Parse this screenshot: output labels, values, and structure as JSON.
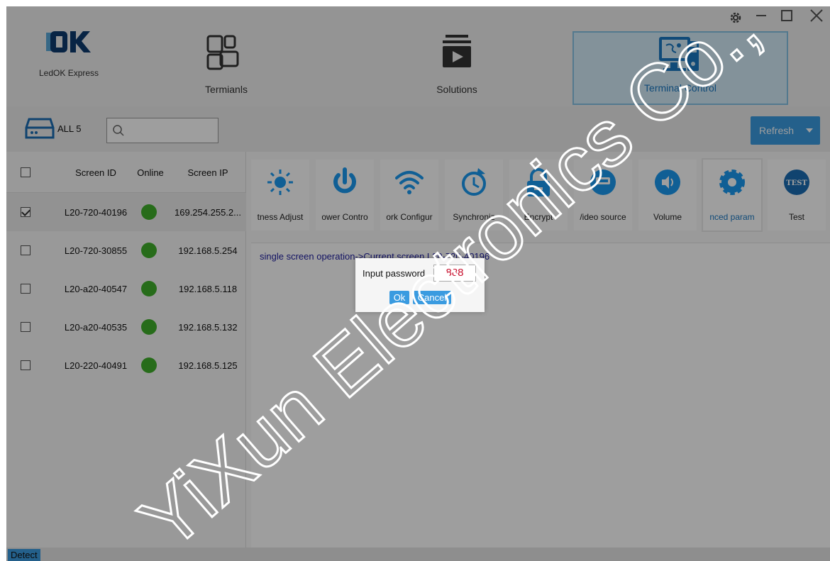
{
  "app": {
    "logo_text": "LedOK Express"
  },
  "nav": {
    "tabs": [
      {
        "label": "Termianls",
        "icon": "terminals-icon"
      },
      {
        "label": "Solutions",
        "icon": "play-stack-icon"
      },
      {
        "label": "Terminal Control",
        "icon": "monitor-control-icon",
        "active": true
      }
    ],
    "window_controls": [
      "gear-icon",
      "minimize-icon",
      "maximize-icon",
      "close-icon"
    ]
  },
  "toolbar": {
    "all_label": "ALL 5",
    "search_placeholder": "",
    "refresh_label": "Refresh"
  },
  "list": {
    "headers": {
      "id": "Screen ID",
      "online": "Online",
      "ip": "Screen IP"
    },
    "rows": [
      {
        "id": "L20-720-40196",
        "ip": "169.254.255.2...",
        "checked": true,
        "online": true
      },
      {
        "id": "L20-720-30855",
        "ip": "192.168.5.254",
        "checked": false,
        "online": true
      },
      {
        "id": "L20-a20-40547",
        "ip": "192.168.5.118",
        "checked": false,
        "online": true
      },
      {
        "id": "L20-a20-40535",
        "ip": "192.168.5.132",
        "checked": false,
        "online": true
      },
      {
        "id": "L20-220-40491",
        "ip": "192.168.5.125",
        "checked": false,
        "online": true
      }
    ]
  },
  "functions": [
    {
      "label": "tness Adjust",
      "icon": "brightness-icon"
    },
    {
      "label": "ower Contro",
      "icon": "power-icon"
    },
    {
      "label": "ork Configur",
      "icon": "wifi-icon"
    },
    {
      "label": "Synchroniz",
      "icon": "sync-clock-icon"
    },
    {
      "label": "Encrypt",
      "icon": "lock-icon"
    },
    {
      "label": "/ideo source",
      "icon": "video-source-icon"
    },
    {
      "label": "Volume",
      "icon": "volume-icon"
    },
    {
      "label": "nced param",
      "icon": "gear-icon",
      "active": true
    },
    {
      "label": "Test",
      "icon": "test-icon"
    }
  ],
  "content": {
    "breadcrumb": "single screen operation->Current screen  L20-720-40196"
  },
  "dialog": {
    "label": "Input password",
    "value": "888",
    "ok": "Ok",
    "cancel": "Cancel"
  },
  "status": {
    "detect": "Detect"
  },
  "watermark": "YiXun Electronics Co.,",
  "colors": {
    "accent": "#3a9be0",
    "online": "#3fae2a",
    "password_text": "#c8102e"
  }
}
